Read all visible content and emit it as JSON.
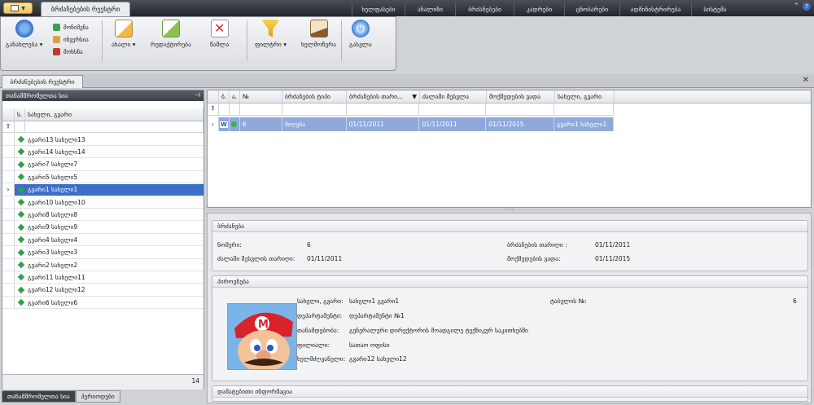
{
  "app": {
    "active_tab": "ბრძანებების რეესტრი",
    "menu_tabs": [
      "ხელფასები",
      "ანალიზი",
      "ბრძანებები",
      "კადრები",
      "ცნობარები",
      "ადმინისტრირება",
      "სისტემა"
    ],
    "icons": [
      "app-menu-icon",
      "collapse-icon",
      "help-icon"
    ]
  },
  "ribbon": {
    "refresh_label": "განახლება",
    "small_buttons": [
      {
        "label": "მონიშვნა",
        "icon": "check-all-icon"
      },
      {
        "label": "ინვერსია",
        "icon": "invert-icon"
      },
      {
        "label": "მოხსნა",
        "icon": "uncheck-icon"
      }
    ],
    "new_label": "ახალი",
    "edit_label": "რედაქტირება",
    "delete_label": "წაშლა",
    "filter_label": "ფილტრი",
    "sign_label": "ხელმოწერა",
    "exit_label": "გასვლა"
  },
  "document_tab": "ბრძანებების რეესტრი",
  "left_panel": {
    "title": "თანამშრომელთა სია",
    "columns": [
      "ს.",
      "სახელი, გვარი"
    ],
    "filter_icon": "filter-icon",
    "rows": [
      "გვარი13 სახელი13",
      "გვარი14 სახელი14",
      "გვარი7 სახელი7",
      "გვარი5 სახელი5",
      "გვარი1 სახელი1",
      "გვარი10 სახელი10",
      "გვარი8 სახელი8",
      "გვარი9 სახელი9",
      "გვარი4 სახელი4",
      "გვარი3 სახელი3",
      "გვარი2 სახელი2",
      "გვარი11 სახელი11",
      "გვარი12 სახელი12",
      "გვარი6 სახელი6"
    ],
    "selected_index": 4,
    "count": "14",
    "bottom_tabs": [
      "თანამშრომელთა სია",
      "პერიოდები"
    ]
  },
  "orders_grid": {
    "columns": [
      "ბ.",
      "ა.",
      "№",
      "ბრძანების ტიპი",
      "ბრძანების თარი...",
      "ძალაში შესვლა",
      "მოქმედების ვადა",
      "სახელი, გვარი"
    ],
    "row": {
      "doc_icon": "W",
      "number": "6",
      "type": "მიღება",
      "order_date": "01/11/2011",
      "effective": "01/11/2011",
      "valid_until": "01/11/2015",
      "name": "გვარი1 სახელი1"
    }
  },
  "details": {
    "order_group": {
      "title": "ბრძანება",
      "number_label": "ნომერი:",
      "number_value": "6",
      "date_label": "ბრძანების თარიღი :",
      "date_value": "01/11/2011",
      "effective_label": "ძალაში შესვლის თარიღი:",
      "effective_value": "01/11/2011",
      "validity_label": "მოქმედების ვადა:",
      "validity_value": "01/11/2015"
    },
    "person_group": {
      "title": "პიროვნება",
      "name_label": "სახელი, გვარი:",
      "name_value": "სახელი1 გვარი1",
      "tabel_label": "ტაბელის №:",
      "tabel_value": "6",
      "dept_label": "დეპარტამენტი:",
      "dept_value": "დეპარტამენტი №1",
      "position_label": "თანამდებობა:",
      "position_value": "გენერალური დირექტორის მოადგილე ტექნიკურ საკითხებში",
      "branch_label": "ფილიალი:",
      "branch_value": "სათაო ოფისი",
      "manager_label": "ხელმძღვანელი:",
      "manager_value": "გვარი12 სახელი12"
    },
    "extra_group": {
      "title": "დამატებითი ინფორმაცია"
    }
  }
}
